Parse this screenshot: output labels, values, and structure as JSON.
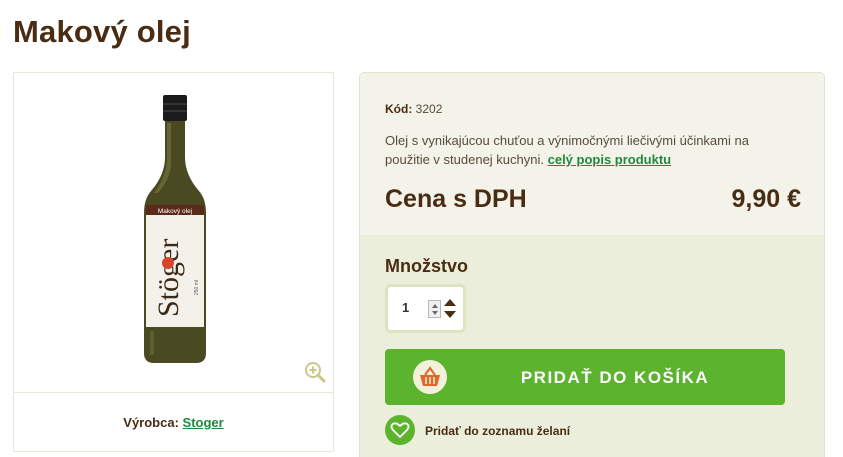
{
  "product": {
    "title": "Makový olej",
    "bottle_label_small": "Makový olej",
    "bottle_brand": "Stöger",
    "bottle_volume": "250 ml"
  },
  "manufacturer": {
    "label": "Výrobca:",
    "name": "Stoger"
  },
  "details": {
    "code_label": "Kód:",
    "code_value": "3202",
    "description": "Olej s vynikajúcou chuťou a výnimočnými liečivými účinkami na použitie v studenej kuchyni.",
    "full_description_link": "celý popis produktu",
    "price_label": "Cena s DPH",
    "price_value": "9,90 €"
  },
  "purchase": {
    "quantity_label": "Množstvo",
    "quantity_value": "1",
    "add_to_cart_label": "PRIDAŤ DO KOŠÍKA",
    "wishlist_label": "Pridať do zoznamu želaní"
  },
  "icons": {
    "zoom": "zoom-in-icon",
    "cart": "basket-icon",
    "wishlist": "heart-icon"
  },
  "colors": {
    "brand_green": "#5bb32e",
    "link_green": "#1e8a3c",
    "text_brown": "#4a2c13",
    "panel_bg": "#f3f3ea",
    "panel_bg_lower": "#eaeedb"
  }
}
